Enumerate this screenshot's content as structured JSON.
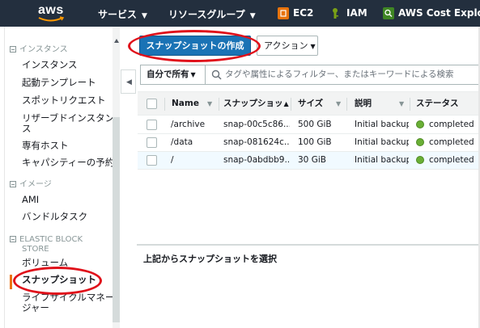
{
  "topnav": {
    "logo": "aws",
    "services_label": "サービス",
    "resource_groups_label": "リソースグループ",
    "shortcuts": [
      {
        "label": "EC2",
        "icon": "ec2-icon",
        "color": "#e8730c"
      },
      {
        "label": "IAM",
        "icon": "iam-icon",
        "color": "#7aa116"
      },
      {
        "label": "AWS Cost Explore",
        "icon": "cost-explorer-icon",
        "color": "#3f8624"
      }
    ]
  },
  "sidebar": {
    "sections": [
      {
        "title": "インスタンス",
        "items": [
          "インスタンス",
          "起動テンプレート",
          "スポットリクエスト",
          "リザーブドインスタンス",
          "専有ホスト",
          "キャパシティーの予約"
        ]
      },
      {
        "title": "イメージ",
        "items": [
          "AMI",
          "バンドルタスク"
        ]
      },
      {
        "title": "ELASTIC BLOCK STORE",
        "items": [
          "ボリューム",
          "スナップショット",
          "ライフサイクルマネージャー"
        ]
      }
    ],
    "reserved_line1": "リザーブドインスタン",
    "reserved_line2": "ス",
    "ebs_line1": "ELASTIC BLOCK",
    "ebs_line2": "STORE",
    "lifecycle_line1": "ライフサイクルマネー",
    "lifecycle_line2": "ジャー",
    "active_item": "スナップショット"
  },
  "toolbar": {
    "create_snapshot_label": "スナップショットの作成",
    "actions_label": "アクション"
  },
  "filter": {
    "owner_label": "自分で所有",
    "placeholder": "タグや属性によるフィルター、またはキーワードによる検索"
  },
  "table": {
    "columns": [
      "Name",
      "スナップショッ",
      "サイズ",
      "説明",
      "ステータス"
    ],
    "rows": [
      {
        "name": "/archive",
        "snapshot_id": "snap-00c5c86...",
        "size": "500 GiB",
        "description": "Initial backup",
        "status": "completed"
      },
      {
        "name": "/data",
        "snapshot_id": "snap-081624c...",
        "size": "100 GiB",
        "description": "Initial backup",
        "status": "completed"
      },
      {
        "name": "/",
        "snapshot_id": "snap-0abdbb9...",
        "size": "30 GiB",
        "description": "Initial backup",
        "status": "completed"
      }
    ]
  },
  "detail": {
    "empty_message": "上記からスナップショットを選択"
  },
  "colors": {
    "nav_bg": "#232f3e",
    "primary_button": "#1a73b5",
    "status_green": "#6aaf35",
    "highlight_red": "#e0101a",
    "active_orange": "#ec7211"
  }
}
